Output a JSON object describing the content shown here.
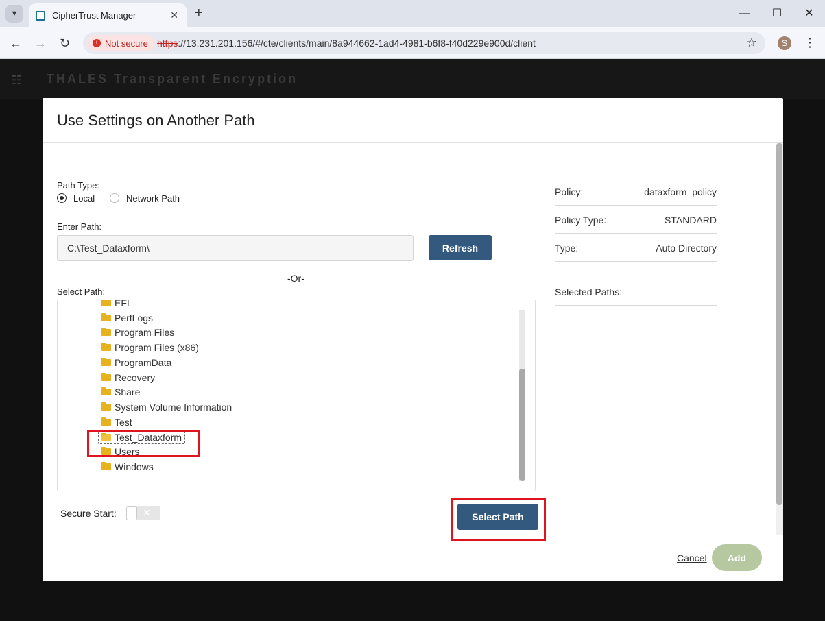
{
  "browser": {
    "tab_title": "CipherTrust Manager",
    "security_label": "Not secure",
    "url_scheme": "https",
    "url_rest": "://13.231.201.156/#/cte/clients/main/8a944662-1ad4-4981-b6f8-f40d229e900d/client",
    "profile_initial": "S"
  },
  "app": {
    "brand": "THALES Transparent Encryption"
  },
  "modal": {
    "title": "Use Settings on Another Path",
    "path_type_label": "Path Type:",
    "radio_local": "Local",
    "radio_network": "Network Path",
    "enter_path_label": "Enter Path:",
    "path_value": "C:\\Test_Dataxform\\",
    "refresh_label": "Refresh",
    "or_label": "-Or-",
    "select_path_label": "Select Path:",
    "tree_items": [
      "EFI",
      "PerfLogs",
      "Program Files",
      "Program Files (x86)",
      "ProgramData",
      "Recovery",
      "Share",
      "System Volume Information",
      "Test",
      "Test_Dataxform",
      "Users",
      "Windows"
    ],
    "selected_item": "Test_Dataxform",
    "secure_start_label": "Secure Start:",
    "select_path_button": "Select Path",
    "info": {
      "policy_label": "Policy:",
      "policy_value": "dataxform_policy",
      "policy_type_label": "Policy Type:",
      "policy_type_value": "STANDARD",
      "type_label": "Type:",
      "type_value": "Auto Directory",
      "selected_paths_label": "Selected Paths:"
    },
    "cancel_label": "Cancel",
    "add_label": "Add"
  }
}
